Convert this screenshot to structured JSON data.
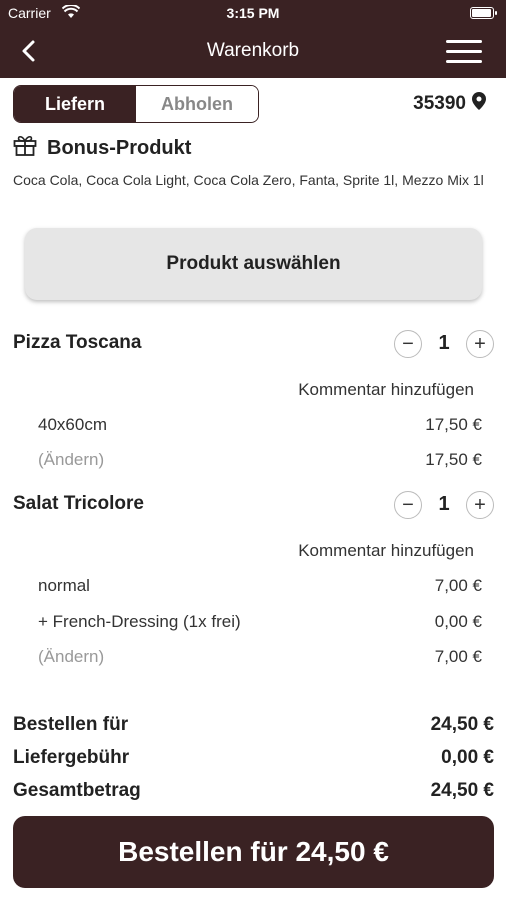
{
  "status": {
    "carrier": "Carrier",
    "time": "3:15 PM"
  },
  "nav": {
    "title": "Warenkorb",
    "back_icon": "chevron-left-icon",
    "menu_icon": "hamburger-menu-icon"
  },
  "delivery": {
    "options": [
      "Liefern",
      "Abholen"
    ],
    "selected": "Liefern",
    "postal_code": "35390"
  },
  "bonus": {
    "title": "Bonus-Produkt",
    "description": "Coca Cola, Coca Cola Light, Coca Cola Zero, Fanta, Sprite 1l, Mezzo Mix 1l",
    "choose_label": "Produkt auswählen"
  },
  "items": [
    {
      "name": "Pizza Toscana",
      "quantity": "1",
      "comment_label": "Kommentar hinzufügen",
      "lines": [
        {
          "label": "40x60cm",
          "price": "17,50 €"
        },
        {
          "label": "(Ändern)",
          "price": "17,50 €"
        }
      ]
    },
    {
      "name": "Salat Tricolore",
      "quantity": "1",
      "comment_label": "Kommentar hinzufügen",
      "lines": [
        {
          "label": "normal",
          "price": "7,00 €"
        },
        {
          "label": "+ French-Dressing (1x frei)",
          "price": "0,00 €"
        },
        {
          "label": "(Ändern)",
          "price": "7,00 €"
        }
      ]
    }
  ],
  "totals": [
    {
      "label": "Bestellen für",
      "value": "24,50 €"
    },
    {
      "label": "Liefergebühr",
      "value": "0,00 €"
    },
    {
      "label": "Gesamtbetrag",
      "value": "24,50 €"
    }
  ],
  "order_button": "Bestellen für 24,50 €",
  "colors": {
    "brand": "#3a2223",
    "button_gray": "#e6e6e6"
  }
}
